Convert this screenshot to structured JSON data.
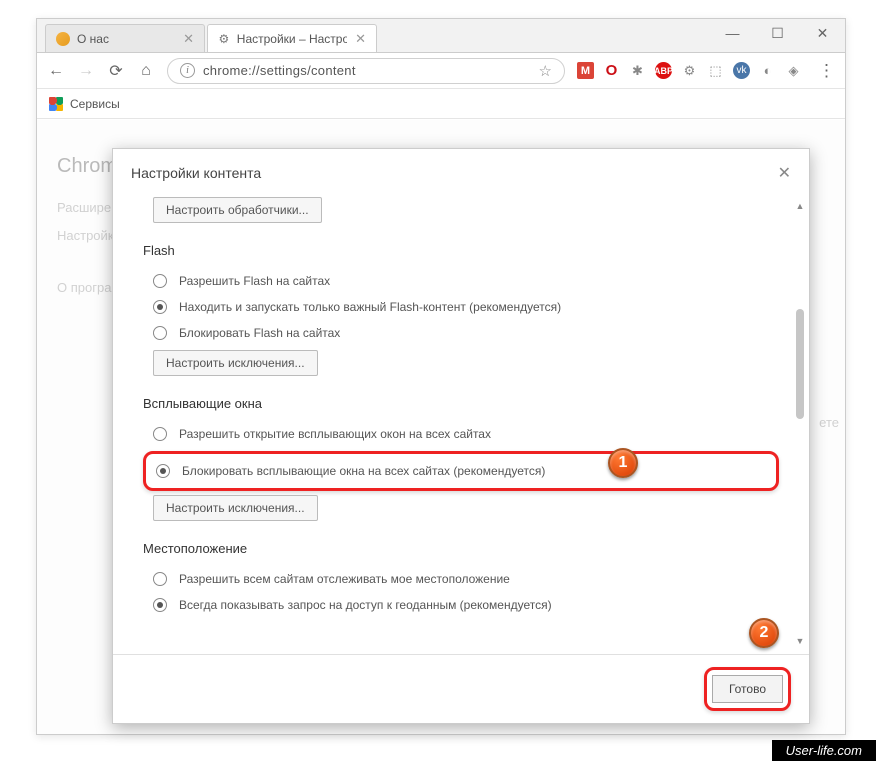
{
  "window": {
    "minimize": "—",
    "maximize": "☐",
    "close": "✕"
  },
  "tabs": [
    {
      "label": "О нас",
      "close": "✕"
    },
    {
      "label": "Настройки – Настройки",
      "close": "✕"
    }
  ],
  "addressBar": {
    "url": "chrome://settings/content",
    "bookmarks_label": "Сервисы"
  },
  "extensions": [
    "M",
    "O",
    "✱",
    "ABP",
    "⚙",
    "⬚",
    "vk",
    "◐",
    "◈"
  ],
  "background": {
    "chrome": "Chrom",
    "extensions": "Расшире",
    "settings": "Настройк",
    "about": "О програ",
    "rightText": "ете"
  },
  "modal": {
    "title": "Настройки контента",
    "close": "✕",
    "handlers_btn": "Настроить обработчики...",
    "sections": {
      "flash": {
        "title": "Flash",
        "options": [
          "Разрешить Flash на сайтах",
          "Находить и запускать только важный Flash-контент (рекомендуется)",
          "Блокировать Flash на сайтах"
        ],
        "exceptions_btn": "Настроить исключения..."
      },
      "popups": {
        "title": "Всплывающие окна",
        "options": [
          "Разрешить открытие всплывающих окон на всех сайтах",
          "Блокировать всплывающие окна на всех сайтах (рекомендуется)"
        ],
        "exceptions_btn": "Настроить исключения..."
      },
      "location": {
        "title": "Местоположение",
        "options": [
          "Разрешить всем сайтам отслеживать мое местоположение",
          "Всегда показывать запрос на доступ к геоданным (рекомендуется)"
        ]
      }
    },
    "done": "Готово"
  },
  "badges": {
    "one": "1",
    "two": "2"
  },
  "watermark": "User-life.com"
}
